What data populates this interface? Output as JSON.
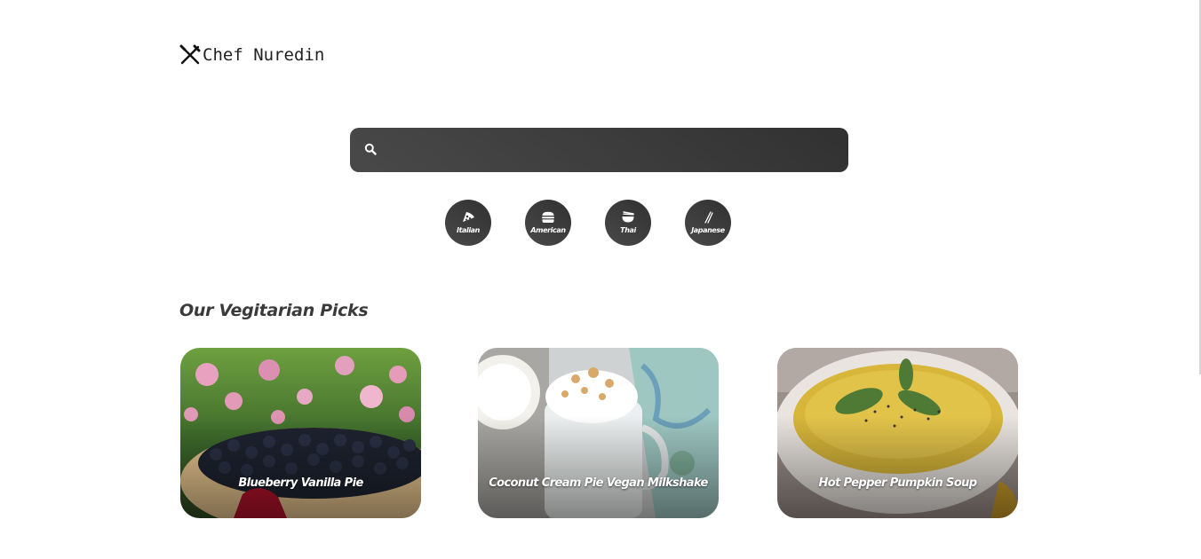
{
  "brand": {
    "name": "Chef Nuredin",
    "icon": "fork-knife-icon"
  },
  "search": {
    "value": "",
    "placeholder": "",
    "icon": "search-icon"
  },
  "cuisines": [
    {
      "label": "Italian",
      "icon": "pizza-icon"
    },
    {
      "label": "American",
      "icon": "burger-icon"
    },
    {
      "label": "Thai",
      "icon": "noodle-bowl-icon"
    },
    {
      "label": "Japanese",
      "icon": "chopsticks-icon"
    }
  ],
  "section": {
    "title": "Our Vegitarian Picks"
  },
  "recipes": [
    {
      "title": "Blueberry Vanilla Pie"
    },
    {
      "title": "Coconut Cream Pie Vegan Milkshake"
    },
    {
      "title": "Hot Pepper Pumpkin Soup"
    }
  ],
  "colors": {
    "dark_gradient_start": "#494949",
    "dark_gradient_end": "#313131",
    "text_dark": "#3a3a3a"
  }
}
